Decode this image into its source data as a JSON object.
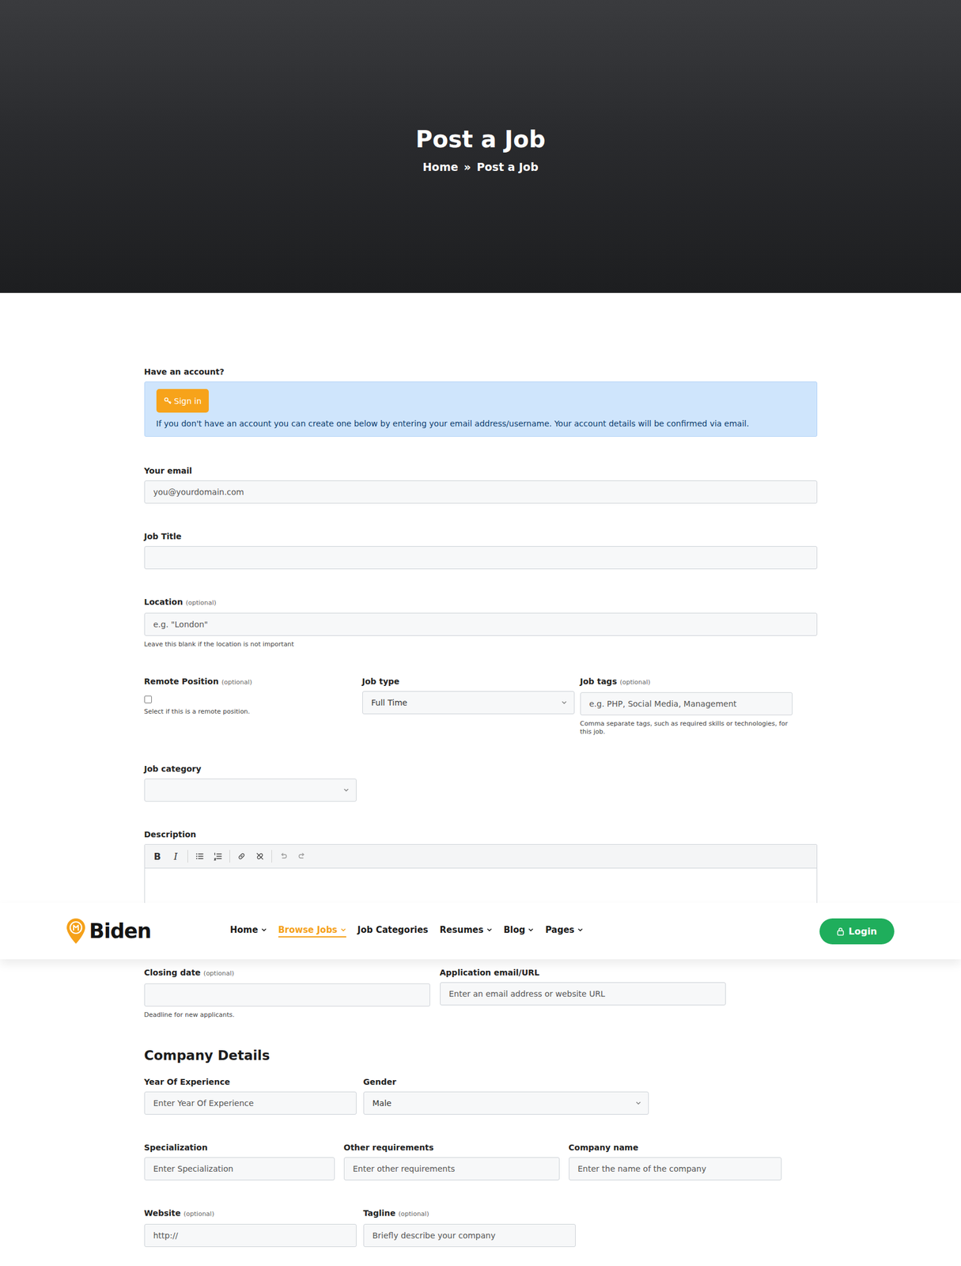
{
  "hero": {
    "title": "Post a Job",
    "breadcrumb": [
      "Home",
      "»",
      "Post a Job"
    ]
  },
  "account": {
    "question": "Have an account?",
    "signin": "Sign in",
    "note": "If you don't have an account you can create one below by entering your email address/username. Your account details will be confirmed via email."
  },
  "form": {
    "rows": [
      [
        {
          "label": "Your email",
          "kind": "input",
          "placeholder": "you@yourdomain.com"
        }
      ],
      [
        {
          "label": "Job Title",
          "kind": "input"
        }
      ],
      [
        {
          "label": "Location",
          "optional": "(optional)",
          "kind": "input",
          "placeholder": "e.g. \"London\"",
          "hint": "Leave this blank if the location is not important"
        }
      ],
      [
        {
          "label": "Remote Position",
          "optional": "(optional)",
          "kind": "checkbox",
          "checked": false,
          "hint": "Select if this is a remote position."
        },
        {
          "label": "Job type",
          "kind": "select",
          "value": "Full Time"
        },
        {
          "label": "Job tags",
          "optional": "(optional)",
          "kind": "input",
          "placeholder": "e.g. PHP, Social Media, Management",
          "hint": "Comma separate tags, such as required skills or technologies, for this job."
        }
      ],
      [
        {
          "label": "Job category",
          "kind": "select",
          "value": ""
        }
      ]
    ],
    "editor": {
      "label": "Description",
      "bold": "B",
      "italic": "I"
    },
    "lower_rows": [
      [
        {
          "label": "Closing date",
          "optional": "(optional)",
          "kind": "input",
          "hint": "Deadline for new applicants."
        },
        {
          "label": "Application email/URL",
          "kind": "input",
          "placeholder": "Enter an email address or website URL"
        }
      ]
    ]
  },
  "company": {
    "title": "Company Details",
    "rows": [
      [
        {
          "label": "Year Of Experience",
          "kind": "input",
          "placeholder": "Enter Year Of Experience"
        },
        {
          "label": "Gender",
          "kind": "select",
          "value": "Male"
        }
      ],
      [
        {
          "label": "Specialization",
          "kind": "input",
          "placeholder": "Enter Specialization"
        },
        {
          "label": "Other requirements",
          "kind": "input",
          "placeholder": "Enter other requirements"
        },
        {
          "label": "Company name",
          "kind": "input",
          "placeholder": "Enter the name of the company"
        }
      ],
      [
        {
          "label": "Website",
          "optional": "(optional)",
          "kind": "input",
          "placeholder": "http://"
        },
        {
          "label": "Tagline",
          "optional": "(optional)",
          "kind": "input",
          "placeholder": "Briefly describe your company"
        }
      ]
    ]
  },
  "header": {
    "logo": "Biden",
    "nav": [
      {
        "label": "Home",
        "has_menu": true,
        "selected": false
      },
      {
        "label": "Browse Jobs",
        "has_menu": true,
        "selected": true
      },
      {
        "label": "Job Categories",
        "has_menu": false,
        "selected": false
      },
      {
        "label": "Resumes",
        "has_menu": true,
        "selected": false
      },
      {
        "label": "Blog",
        "has_menu": true,
        "selected": false
      },
      {
        "label": "Pages",
        "has_menu": true,
        "selected": false
      }
    ],
    "login": "Login"
  }
}
